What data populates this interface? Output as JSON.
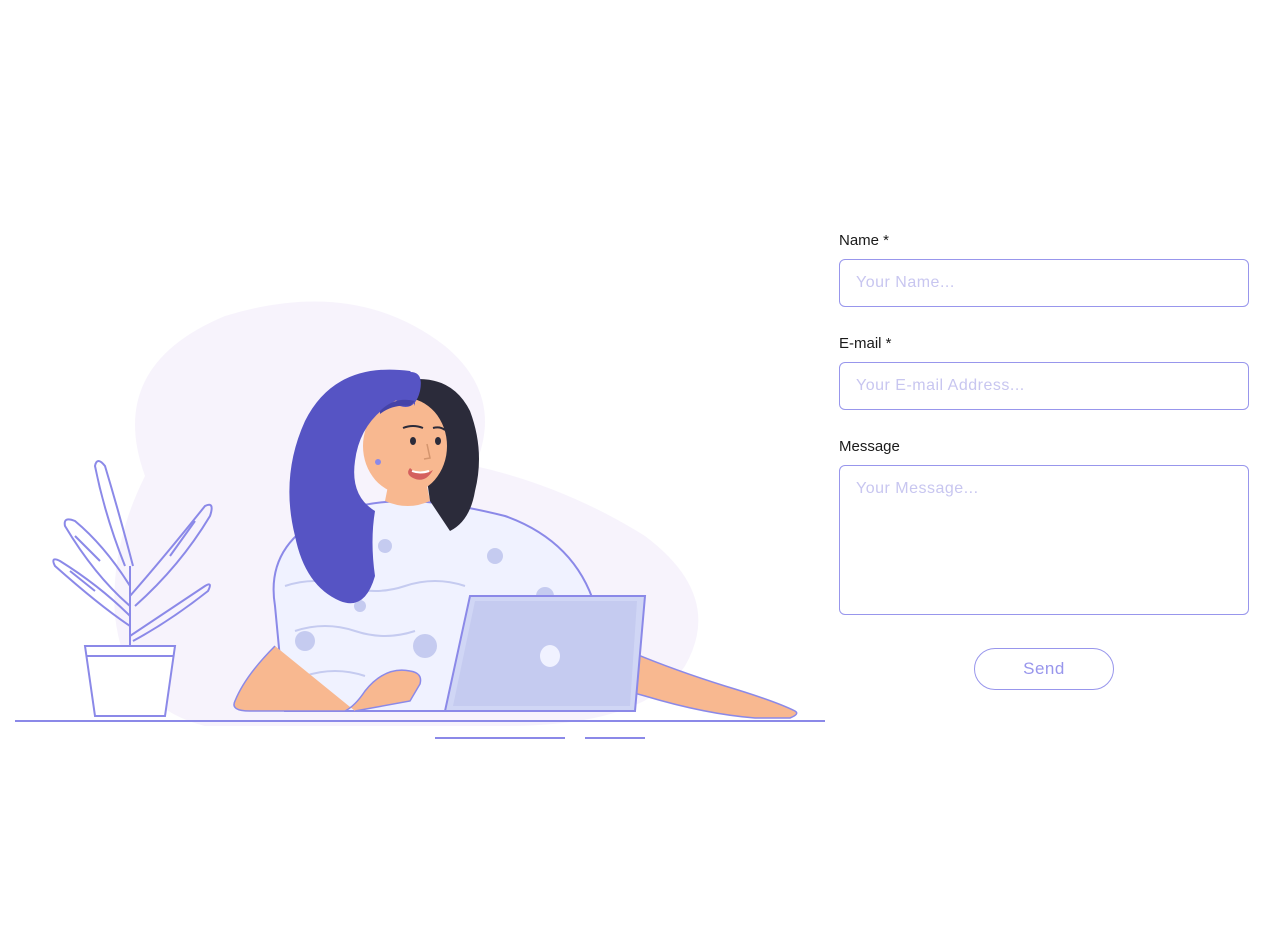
{
  "form": {
    "fields": {
      "name": {
        "label": "Name *",
        "placeholder": "Your Name..."
      },
      "email": {
        "label": "E-mail *",
        "placeholder": "Your E-mail Address..."
      },
      "message": {
        "label": "Message",
        "placeholder": "Your Message..."
      }
    },
    "submit_label": "Send"
  },
  "colors": {
    "accent": "#9896ec",
    "placeholder": "#c8c6f0",
    "text": "#1a1a1a"
  }
}
